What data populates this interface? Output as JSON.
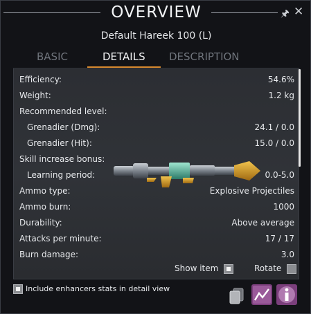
{
  "window": {
    "title": "OVERVIEW",
    "subtitle": "Default Hareek 100 (L)",
    "pin_icon": "pin-icon",
    "close_icon": "close-icon"
  },
  "tabs": [
    {
      "label": "BASIC",
      "active": false
    },
    {
      "label": "DETAILS",
      "active": true
    },
    {
      "label": "DESCRIPTION",
      "active": false
    }
  ],
  "stats": [
    {
      "label": "Efficiency:",
      "value": "54.6%"
    },
    {
      "label": "Weight:",
      "value": "1.2 kg"
    },
    {
      "label": "Recommended level:",
      "value": ""
    },
    {
      "label": "Grenadier (Dmg):",
      "value": "24.1 / 0.0"
    },
    {
      "label": "Grenadier (Hit):",
      "value": "15.0 / 0.0"
    },
    {
      "label": "Skill increase bonus:",
      "value": ""
    },
    {
      "label": "Learning period:",
      "value": "0.0-5.0"
    },
    {
      "label": "Ammo type:",
      "value": "Explosive Projectiles"
    },
    {
      "label": "Ammo burn:",
      "value": "1000"
    },
    {
      "label": "Durability:",
      "value": "Above average"
    },
    {
      "label": "Attacks per minute:",
      "value": "17 / 17"
    },
    {
      "label": "Burn damage:",
      "value": "3.0"
    }
  ],
  "options": {
    "show_item_label": "Show item",
    "show_item_checked": true,
    "rotate_label": "Rotate",
    "rotate_checked": false,
    "include_enhancers_label": "Include enhancers stats in detail view",
    "include_enhancers_checked": true
  },
  "buttons": {
    "compare_icon": "stack-icon",
    "graph_icon": "graph-icon",
    "info_icon": "info-icon"
  },
  "colors": {
    "accent": "#d8892f",
    "panel_bg": "#2e3035",
    "window_bg": "#121317"
  }
}
